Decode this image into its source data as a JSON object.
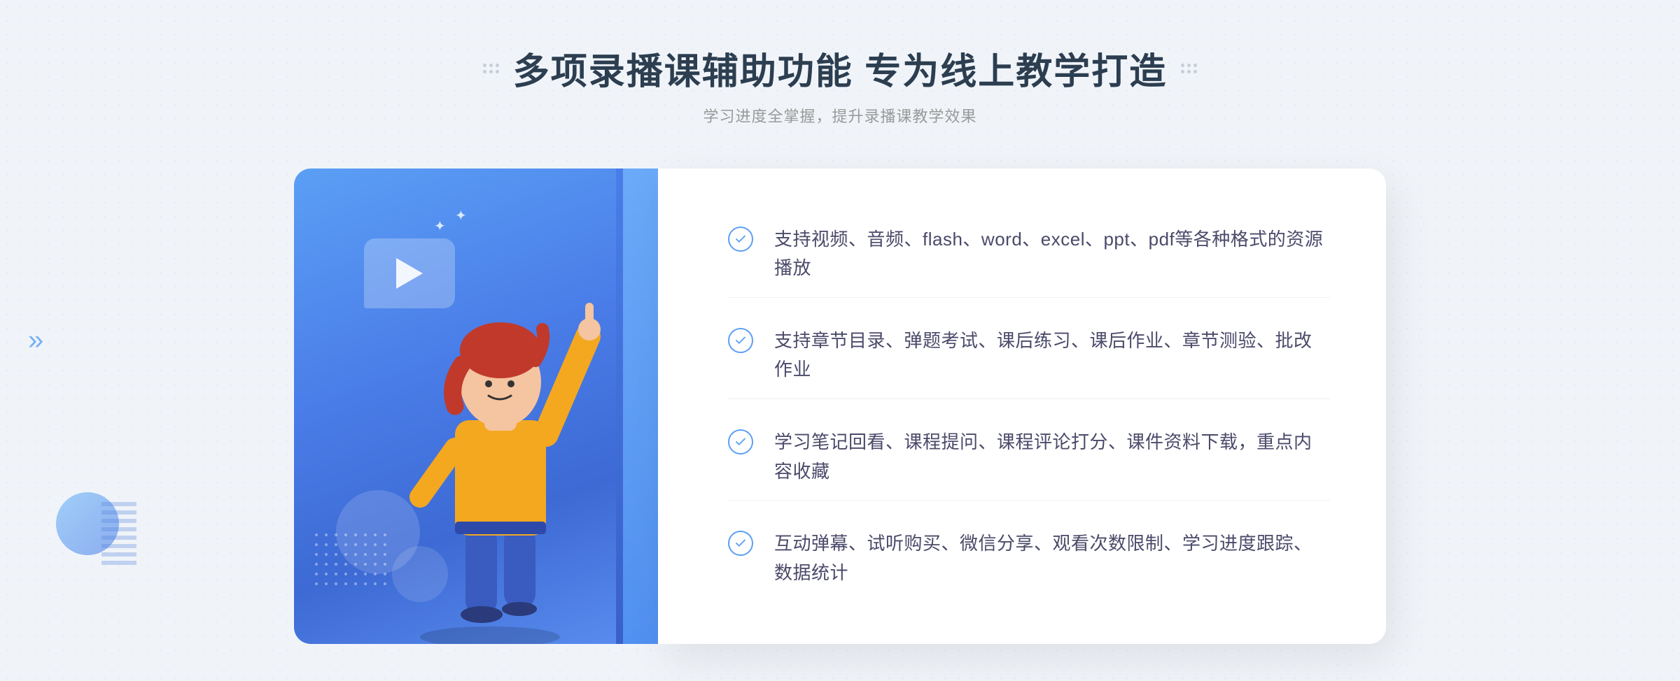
{
  "header": {
    "title": "多项录播课辅助功能 专为线上教学打造",
    "subtitle": "学习进度全掌握，提升录播课教学效果"
  },
  "features": [
    {
      "id": "feature-1",
      "text": "支持视频、音频、flash、word、excel、ppt、pdf等各种格式的资源播放"
    },
    {
      "id": "feature-2",
      "text": "支持章节目录、弹题考试、课后练习、课后作业、章节测验、批改作业"
    },
    {
      "id": "feature-3",
      "text": "学习笔记回看、课程提问、课程评论打分、课件资料下载，重点内容收藏"
    },
    {
      "id": "feature-4",
      "text": "互动弹幕、试听购买、微信分享、观看次数限制、学习进度跟踪、数据统计"
    }
  ],
  "decorative": {
    "dots_left_icon": "decoration-dots-left",
    "dots_right_icon": "decoration-dots-right",
    "chevron_left": "«",
    "check_color": "#5b9ff5"
  }
}
